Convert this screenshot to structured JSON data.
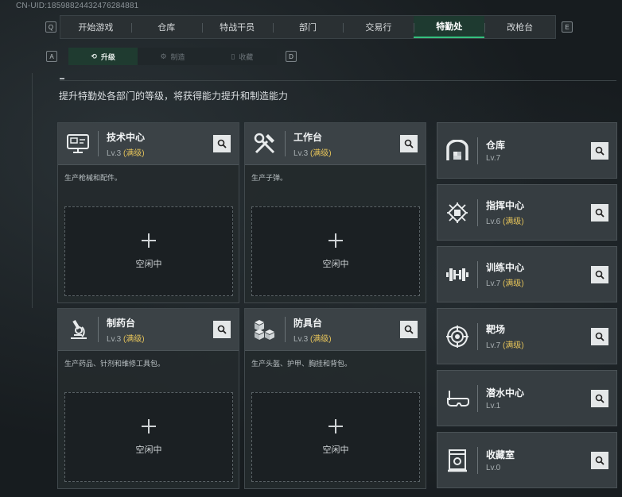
{
  "uid_text": "CN-UID:18598824432476284881",
  "topnav": {
    "left_key": "Q",
    "right_key": "E",
    "tabs": [
      "开始游戏",
      "仓库",
      "特战干员",
      "部门",
      "交易行",
      "特勤处",
      "改枪台"
    ],
    "active_index": 5
  },
  "subnav": {
    "left_key": "A",
    "right_key": "D",
    "tabs": [
      {
        "label": "升级",
        "icon": "upgrade-icon"
      },
      {
        "label": "制造",
        "icon": "craft-icon"
      },
      {
        "label": "收藏",
        "icon": "collect-icon"
      }
    ],
    "active_index": 0
  },
  "description": "提升特勤处各部门的等级，将获得能力提升和制造能力",
  "departments": [
    {
      "name": "技术中心",
      "level": "Lv.3",
      "max": "(满级)",
      "desc": "生产枪械和配件。",
      "slot_label": "空闲中",
      "icon": "computer-icon"
    },
    {
      "name": "工作台",
      "level": "Lv.3",
      "max": "(满级)",
      "desc": "生产子弹。",
      "slot_label": "空闲中",
      "icon": "tools-icon"
    },
    {
      "name": "制药台",
      "level": "Lv.3",
      "max": "(满级)",
      "desc": "生产药品、针剂和维修工具包。",
      "slot_label": "空闲中",
      "icon": "microscope-icon"
    },
    {
      "name": "防具台",
      "level": "Lv.3",
      "max": "(满级)",
      "desc": "生产头盔、护甲、胸挂和背包。",
      "slot_label": "空闲中",
      "icon": "armor-boxes-icon"
    }
  ],
  "facilities": [
    {
      "name": "仓库",
      "level": "Lv.7",
      "max": "",
      "icon": "warehouse-icon"
    },
    {
      "name": "指挥中心",
      "level": "Lv.6",
      "max": "(满级)",
      "icon": "chip-icon"
    },
    {
      "name": "训练中心",
      "level": "Lv.7",
      "max": "(满级)",
      "icon": "dumbbell-icon"
    },
    {
      "name": "靶场",
      "level": "Lv.7",
      "max": "(满级)",
      "icon": "target-icon"
    },
    {
      "name": "潜水中心",
      "level": "Lv.1",
      "max": "",
      "icon": "diving-mask-icon"
    },
    {
      "name": "收藏室",
      "level": "Lv.0",
      "max": "",
      "icon": "collection-case-icon"
    }
  ],
  "colors": {
    "accent": "#36c07f",
    "max_level": "#e6c45a",
    "card_head": "#3b4246"
  }
}
